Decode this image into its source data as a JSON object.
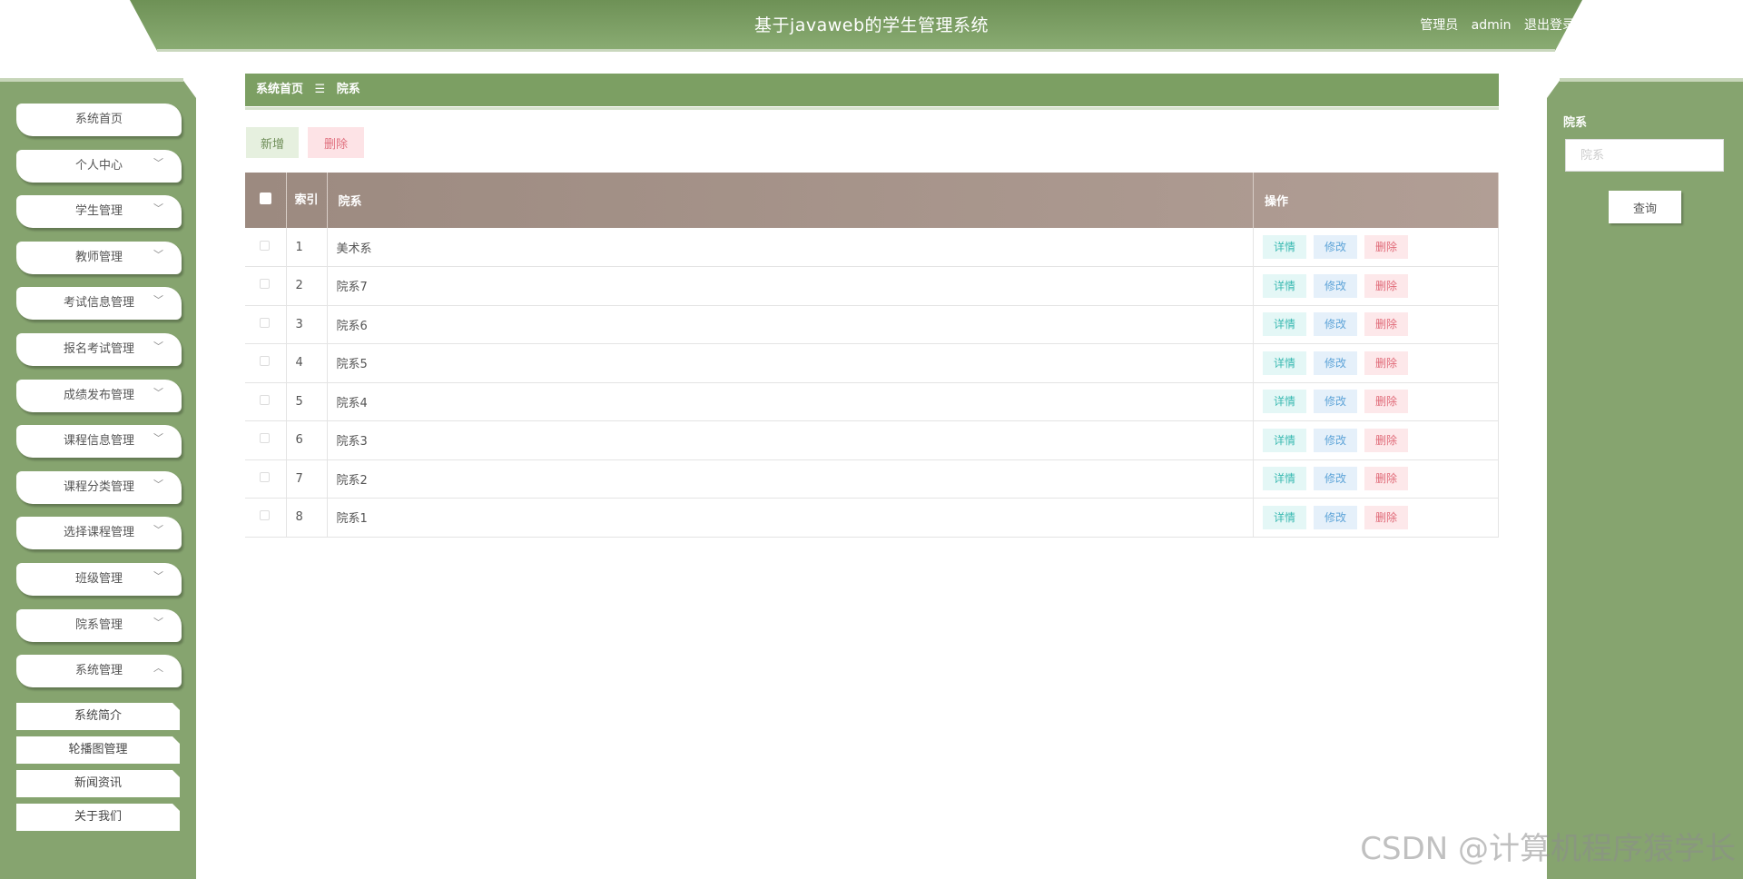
{
  "header": {
    "title": "基于javaweb的学生管理系统",
    "role": "管理员",
    "username": "admin",
    "logout": "退出登录"
  },
  "sidebar": {
    "items": [
      {
        "label": "系统首页",
        "expandable": false
      },
      {
        "label": "个人中心",
        "expandable": true
      },
      {
        "label": "学生管理",
        "expandable": true
      },
      {
        "label": "教师管理",
        "expandable": true
      },
      {
        "label": "考试信息管理",
        "expandable": true
      },
      {
        "label": "报名考试管理",
        "expandable": true
      },
      {
        "label": "成绩发布管理",
        "expandable": true
      },
      {
        "label": "课程信息管理",
        "expandable": true
      },
      {
        "label": "课程分类管理",
        "expandable": true
      },
      {
        "label": "选择课程管理",
        "expandable": true
      },
      {
        "label": "班级管理",
        "expandable": true
      },
      {
        "label": "院系管理",
        "expandable": true
      },
      {
        "label": "系统管理",
        "expandable": true,
        "expanded": true
      }
    ],
    "submenu": [
      "系统简介",
      "轮播图管理",
      "新闻资讯",
      "关于我们"
    ],
    "chevron_down": "﹀",
    "chevron_up": "︿"
  },
  "breadcrumb": {
    "home": "系统首页",
    "separator": "☰",
    "current": "院系"
  },
  "toolbar": {
    "add": "新增",
    "delete": "删除"
  },
  "table": {
    "headers": {
      "index": "索引",
      "department": "院系",
      "actions": "操作"
    },
    "rows": [
      {
        "index": "1",
        "department": "美术系"
      },
      {
        "index": "2",
        "department": "院系7"
      },
      {
        "index": "3",
        "department": "院系6"
      },
      {
        "index": "4",
        "department": "院系5"
      },
      {
        "index": "5",
        "department": "院系4"
      },
      {
        "index": "6",
        "department": "院系3"
      },
      {
        "index": "7",
        "department": "院系2"
      },
      {
        "index": "8",
        "department": "院系1"
      }
    ],
    "row_actions": {
      "detail": "详情",
      "edit": "修改",
      "delete": "删除"
    }
  },
  "search": {
    "label": "院系",
    "placeholder": "院系",
    "button": "查询"
  },
  "watermark": "CSDN @计算机程序猿学长",
  "colors": {
    "primary_green": "#86a46f",
    "header_green": "#6e9156",
    "table_header": "#a89690",
    "delete_red": "#e06a78",
    "detail_teal": "#39b9b1",
    "edit_blue": "#5ea4d8"
  }
}
